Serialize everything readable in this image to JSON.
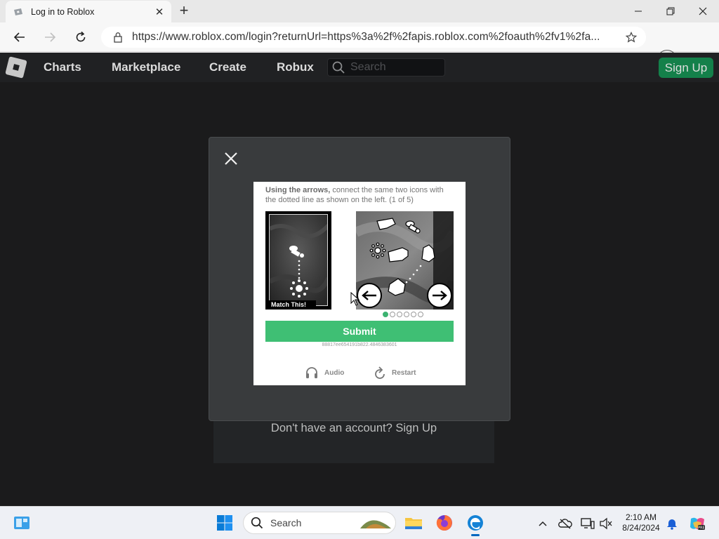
{
  "browser": {
    "tab_title": "Log in to Roblox",
    "url": "https://www.roblox.com/login?returnUrl=https%3a%2f%2fapis.roblox.com%2foauth%2fv1%2fa..."
  },
  "roblox_nav": {
    "links": [
      "Charts",
      "Marketplace",
      "Create",
      "Robux"
    ],
    "search_placeholder": "Search",
    "signup_label": "Sign Up"
  },
  "page": {
    "signup_prompt": "Don't have an account? Sign Up"
  },
  "captcha": {
    "instruction_bold": "Using the arrows,",
    "instruction_rest": " connect the same two icons with the dotted line as shown on the left. (1 of 5)",
    "reference_caption": "Match This!",
    "submit_label": "Submit",
    "session_id": "88817ee654191b822.4846383601",
    "audio_label": "Audio",
    "restart_label": "Restart",
    "page_indicator": {
      "current": 1,
      "total": 6
    }
  },
  "taskbar": {
    "search_placeholder": "Search",
    "time": "2:10 AM",
    "date": "8/24/2024",
    "apps": [
      "file-explorer",
      "firefox",
      "edge"
    ]
  },
  "colors": {
    "roblox_nav_bg": "#202123",
    "roblox_signup": "#14804a",
    "submit_green": "#3fbf74",
    "modal_bg": "#393b3d"
  }
}
